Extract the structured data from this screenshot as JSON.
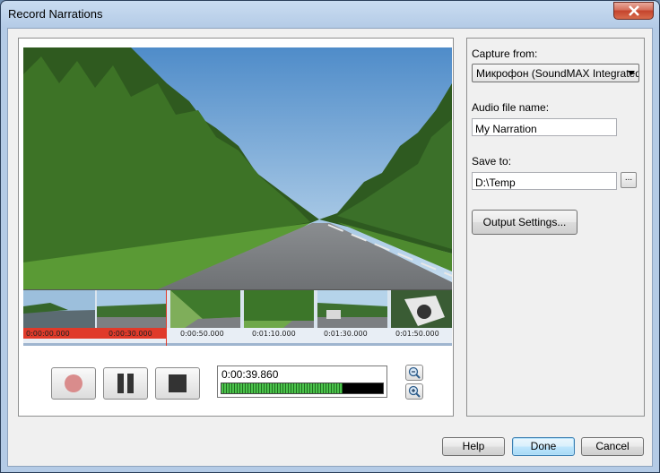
{
  "window": {
    "title": "Record Narrations"
  },
  "preview": {
    "timeline": {
      "labels": [
        "0:00:00.000",
        "0:00:30.000",
        "0:00:50.000",
        "0:01:10.000",
        "0:01:30.000",
        "0:01:50.000"
      ]
    },
    "recorder": {
      "time": "0:00:39.860",
      "level_fraction": 0.75
    }
  },
  "settings": {
    "capture_label": "Capture from:",
    "capture_value": "Микрофон (SoundMAX Integrated",
    "filename_label": "Audio file name:",
    "filename_value": "My Narration",
    "saveto_label": "Save to:",
    "saveto_value": "D:\\Temp",
    "browse_label": "...",
    "output_settings_label": "Output Settings..."
  },
  "footer": {
    "help_label": "Help",
    "done_label": "Done",
    "cancel_label": "Cancel"
  }
}
